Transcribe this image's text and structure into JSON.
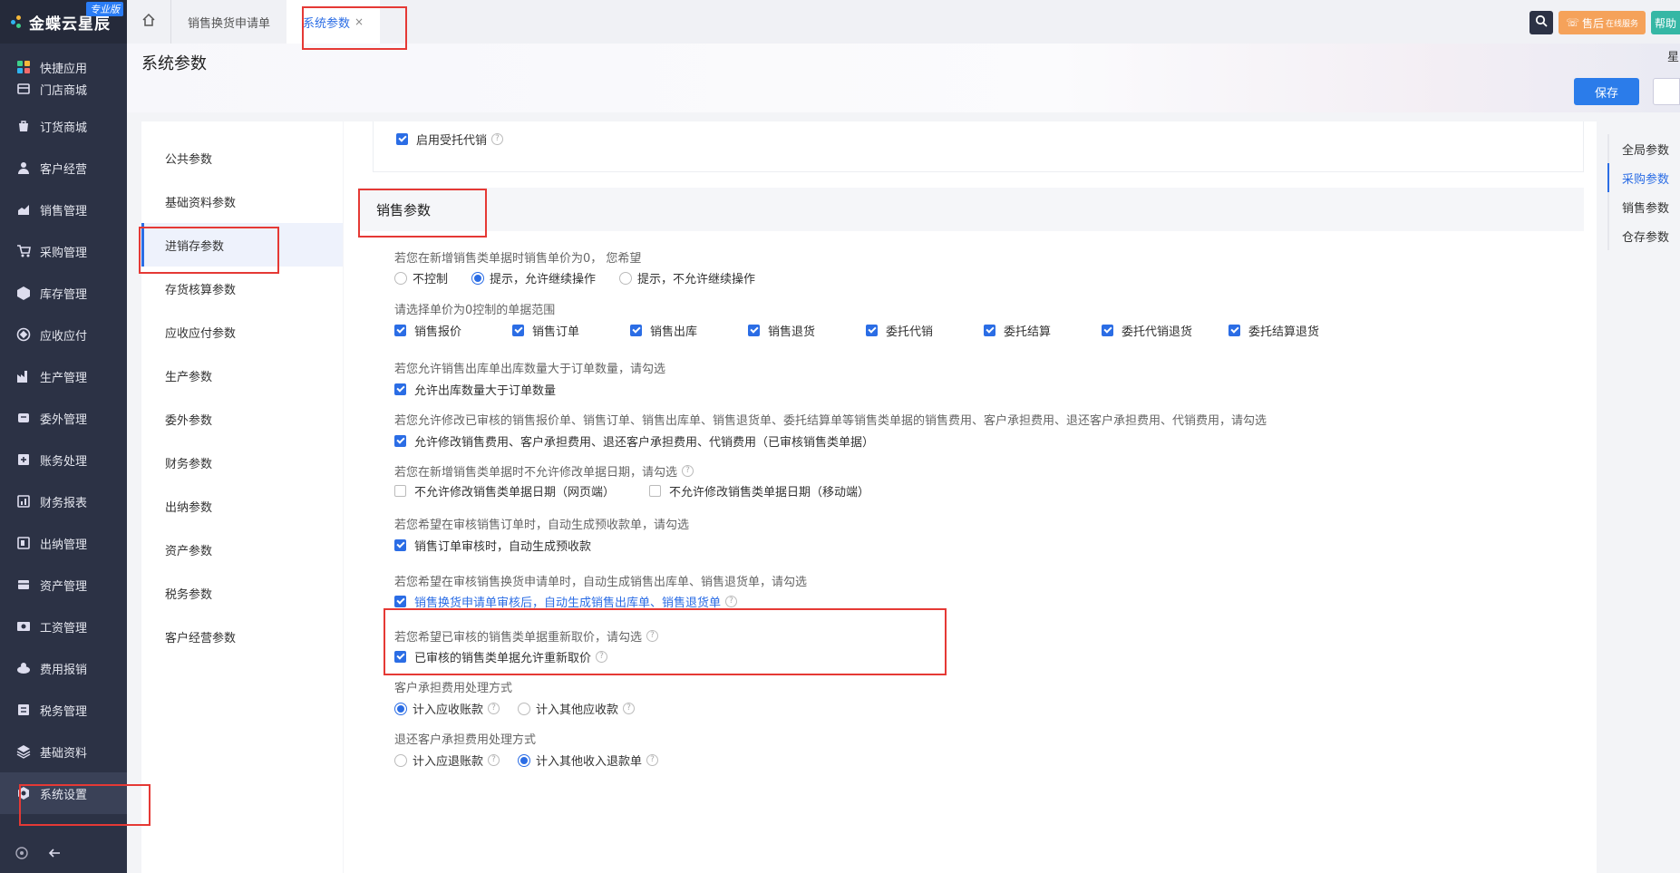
{
  "app": {
    "brand": "金蝶云星辰",
    "edition": "专业版"
  },
  "nav": {
    "items": [
      {
        "label": "快捷应用",
        "icon": "apps-icon"
      },
      {
        "label": "门店商城",
        "icon": "store-icon"
      },
      {
        "label": "订货商城",
        "icon": "bag-icon"
      },
      {
        "label": "客户经营",
        "icon": "customer-icon"
      },
      {
        "label": "销售管理",
        "icon": "sales-icon"
      },
      {
        "label": "采购管理",
        "icon": "cart-icon"
      },
      {
        "label": "库存管理",
        "icon": "box-icon"
      },
      {
        "label": "应收应付",
        "icon": "receivable-icon"
      },
      {
        "label": "生产管理",
        "icon": "factory-icon"
      },
      {
        "label": "委外管理",
        "icon": "outsource-icon"
      },
      {
        "label": "账务处理",
        "icon": "ledger-icon"
      },
      {
        "label": "财务报表",
        "icon": "report-icon"
      },
      {
        "label": "出纳管理",
        "icon": "cashier-icon"
      },
      {
        "label": "资产管理",
        "icon": "asset-icon"
      },
      {
        "label": "工资管理",
        "icon": "salary-icon"
      },
      {
        "label": "费用报销",
        "icon": "expense-icon"
      },
      {
        "label": "税务管理",
        "icon": "tax-icon"
      },
      {
        "label": "基础资料",
        "icon": "layers-icon"
      },
      {
        "label": "系统设置",
        "icon": "settings-icon"
      }
    ]
  },
  "tabs": [
    {
      "label": "销售换货申请单"
    },
    {
      "label": "系统参数",
      "close": "×"
    }
  ],
  "topbar": {
    "service": "售后",
    "service_sub": "在线服务",
    "help": "帮助"
  },
  "header": {
    "title": "系统参数",
    "save": "保存",
    "side_label": "星"
  },
  "leftmenu": [
    "公共参数",
    "基础资料参数",
    "进销存参数",
    "存货核算参数",
    "应收应付参数",
    "生产参数",
    "委外参数",
    "财务参数",
    "出纳参数",
    "资产参数",
    "税务参数",
    "客户经营参数"
  ],
  "anchors": [
    "全局参数",
    "采购参数",
    "销售参数",
    "仓存参数"
  ],
  "content": {
    "consign": "启用受托代销",
    "section": "销售参数",
    "zero_price_q": "若您在新增销售类单据时销售单价为0， 您希望",
    "zero_price_opts": [
      "不控制",
      "提示，允许继续操作",
      "提示，不允许继续操作"
    ],
    "scope_q": "请选择单价为0控制的单据范围",
    "scope_opts": [
      "销售报价",
      "销售订单",
      "销售出库",
      "销售退货",
      "委托代销",
      "委托结算",
      "委托代销退货",
      "委托结算退货"
    ],
    "over_q": "若您允许销售出库单出库数量大于订单数量，请勾选",
    "over_opt": "允许出库数量大于订单数量",
    "modify_q": "若您允许修改已审核的销售报价单、销售订单、销售出库单、销售退货单、委托结算单等销售类单据的销售费用、客户承担费用、退还客户承担费用、代销费用，请勾选",
    "modify_opt": "允许修改销售费用、客户承担费用、退还客户承担费用、代销费用（已审核销售类单据）",
    "date_q": "若您在新增销售类单据时不允许修改单据日期，请勾选",
    "date_opts": [
      "不允许修改销售类单据日期（网页端）",
      "不允许修改销售类单据日期（移动端）"
    ],
    "prepay_q": "若您希望在审核销售订单时，自动生成预收款单，请勾选",
    "prepay_opt": "销售订单审核时，自动生成预收款",
    "exchange_q": "若您希望在审核销售换货申请单时，自动生成销售出库单、销售退货单，请勾选",
    "exchange_opt": "销售换货申请单审核后，自动生成销售出库单、销售退货单",
    "reprice_q": "若您希望已审核的销售类单据重新取价，请勾选",
    "reprice_opt": "已审核的销售类单据允许重新取价",
    "cust_fee_q": "客户承担费用处理方式",
    "cust_fee_opts": [
      "计入应收账款",
      "计入其他应收款"
    ],
    "refund_fee_q": "退还客户承担费用处理方式",
    "refund_fee_opts": [
      "计入应退账款",
      "计入其他收入退款单"
    ]
  },
  "colors": {
    "accent": "#2b6de5",
    "sidebar": "#2c3245",
    "annotation": "#e53935"
  }
}
